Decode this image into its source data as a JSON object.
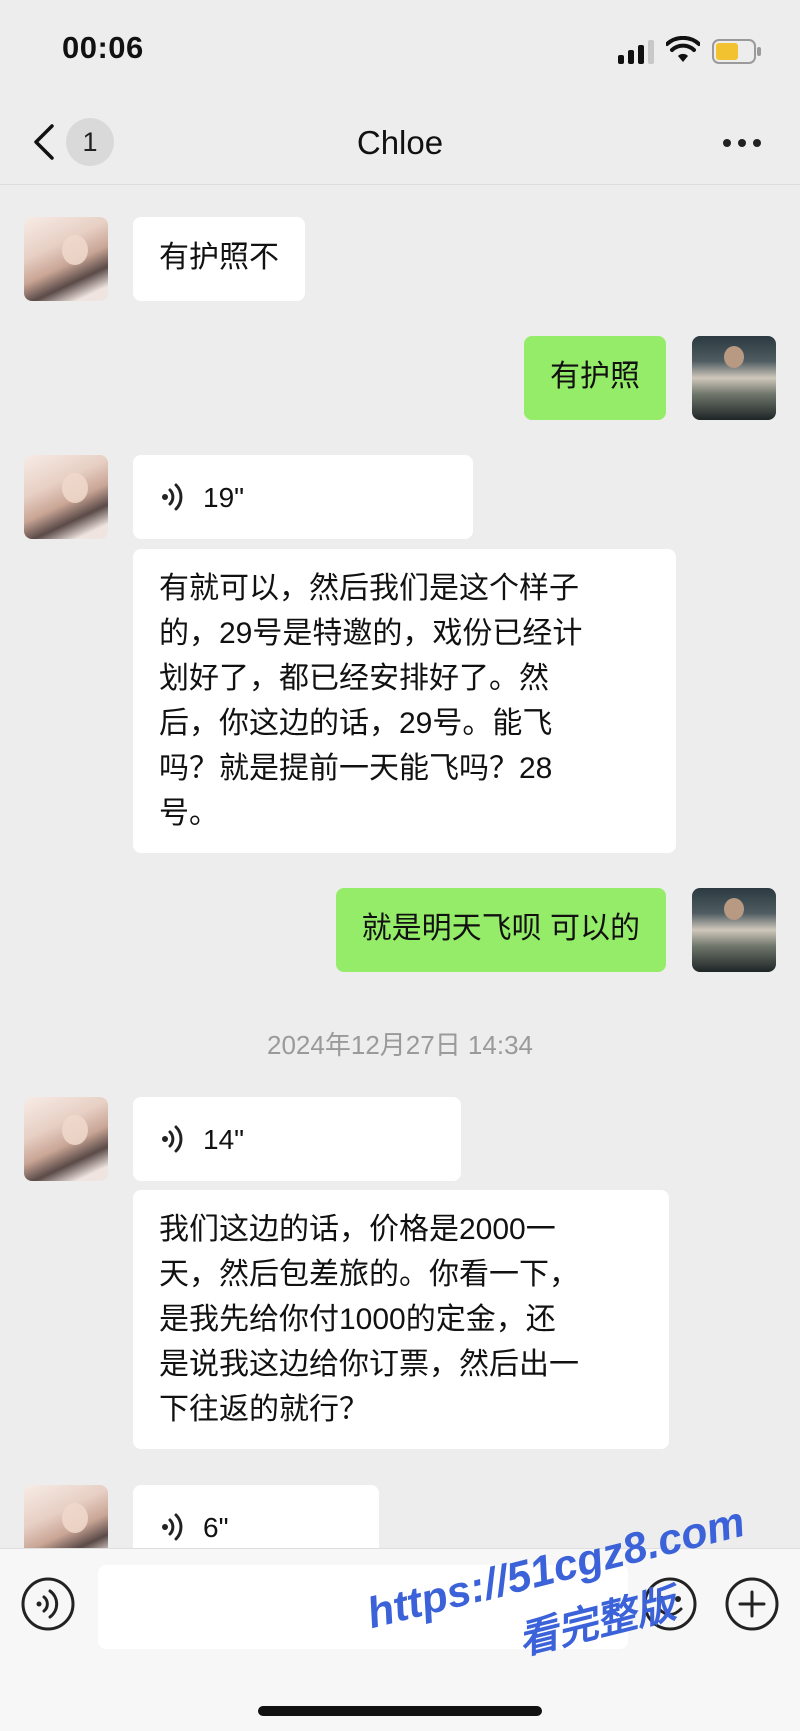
{
  "status_bar": {
    "time": "00:06"
  },
  "nav": {
    "unread_count": "1",
    "title": "Chloe"
  },
  "messages": [
    {
      "side": "in",
      "type": "text",
      "text": "有护照不"
    },
    {
      "side": "out",
      "type": "text",
      "text": "有护照"
    },
    {
      "side": "in",
      "type": "voice",
      "duration": "19\""
    },
    {
      "side": "in",
      "type": "text",
      "lines": [
        "有就可以，然后我们是这个样子",
        "的，29号是特邀的，戏份已经计",
        "划好了，都已经安排好了。然",
        "后，你这边的话，29号。能飞",
        "吗？就是提前一天能飞吗？28",
        "号。"
      ]
    },
    {
      "side": "out",
      "type": "text",
      "text": "就是明天飞呗 可以的"
    },
    {
      "type": "timestamp",
      "text": "2024年12月27日 14:34"
    },
    {
      "side": "in",
      "type": "voice",
      "duration": "14\""
    },
    {
      "side": "in",
      "type": "text",
      "lines": [
        "我们这边的话，价格是2000一",
        "天，然后包差旅的。你看一下，",
        "是我先给你付1000的定金，还",
        "是说我这边给你订票，然后出一",
        "下往返的就行？"
      ]
    },
    {
      "side": "in",
      "type": "voice",
      "duration": "6\""
    }
  ],
  "input_bar": {
    "placeholder": ""
  },
  "watermark": {
    "line1": "https://51cgz8.com",
    "line2": "看完整版"
  },
  "colors": {
    "outgoing_bubble": "#95ec69",
    "incoming_bubble": "#ffffff",
    "background": "#ededed",
    "watermark": "#3b62d8"
  }
}
